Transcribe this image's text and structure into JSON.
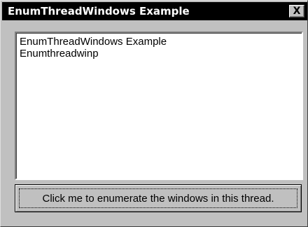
{
  "window": {
    "title": "EnumThreadWindows Example",
    "close_glyph": "X"
  },
  "listbox": {
    "items": [
      {
        "label": "EnumThreadWindows Example"
      },
      {
        "label": "Enumthreadwinp"
      }
    ]
  },
  "action_button": {
    "label": "Click me to enumerate the windows in this thread."
  },
  "colors": {
    "titlebar": "#000000",
    "face": "#c0c0c0",
    "list_background": "#ffffff"
  }
}
